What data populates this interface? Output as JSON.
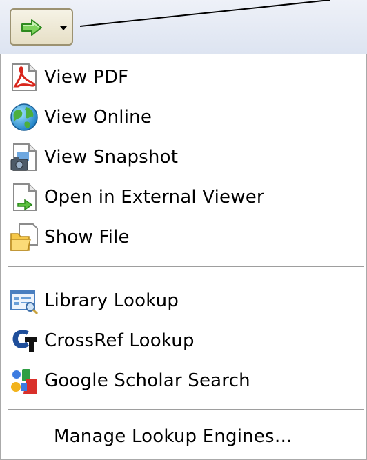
{
  "toolbar": {
    "button_icon": "green-arrow-icon",
    "dropdown_icon": "dropdown-caret-icon"
  },
  "menu": {
    "groups": [
      [
        {
          "label": "View PDF",
          "icon": "pdf-icon"
        },
        {
          "label": "View Online",
          "icon": "globe-icon"
        },
        {
          "label": "View Snapshot",
          "icon": "snapshot-icon"
        },
        {
          "label": "Open in External Viewer",
          "icon": "external-viewer-icon"
        },
        {
          "label": "Show File",
          "icon": "folder-icon"
        }
      ],
      [
        {
          "label": "Library Lookup",
          "icon": "library-lookup-icon"
        },
        {
          "label": "CrossRef Lookup",
          "icon": "crossref-icon"
        },
        {
          "label": "Google Scholar Search",
          "icon": "google-scholar-icon"
        }
      ],
      [
        {
          "label": "Manage Lookup Engines…"
        }
      ]
    ]
  },
  "colors": {
    "arrow_green": "#3cae2a",
    "pdf_red": "#d9261c",
    "separator": "#9e9e9e"
  }
}
